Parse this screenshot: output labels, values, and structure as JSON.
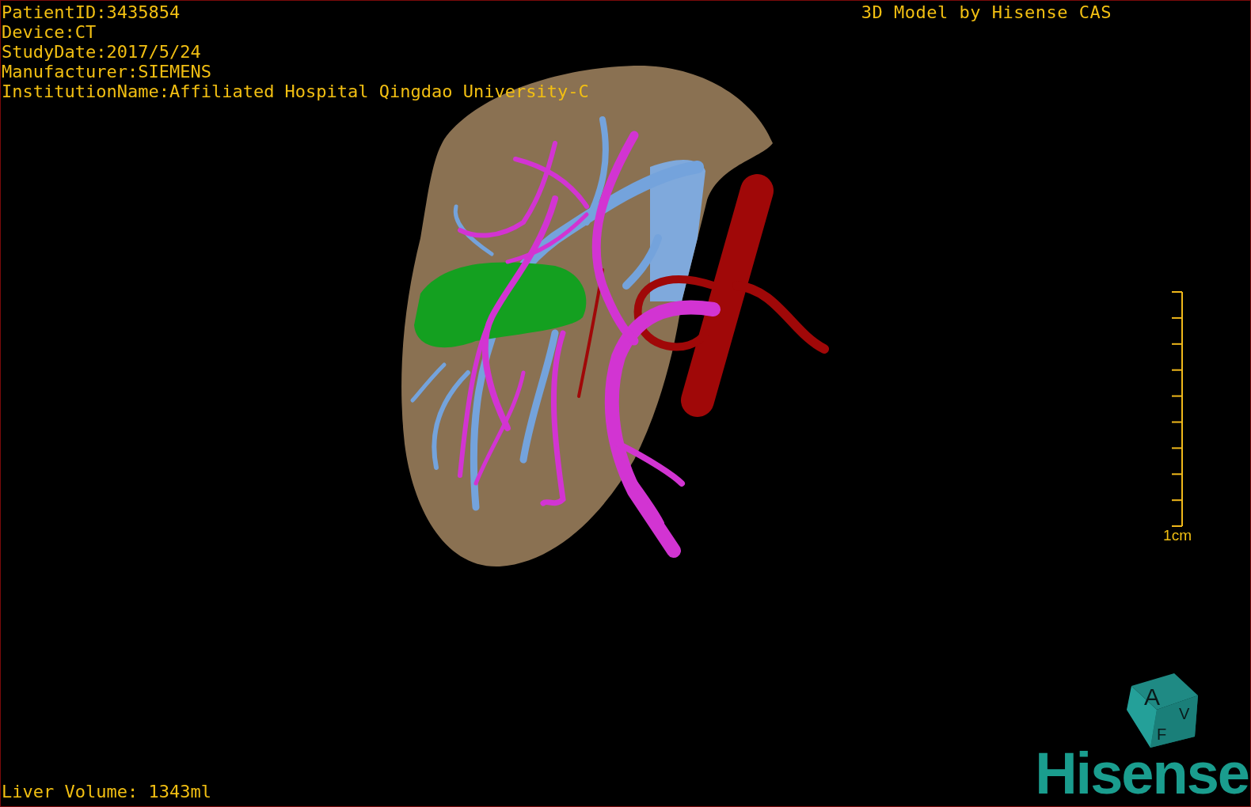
{
  "header": {
    "info_lines": [
      "PatientID:3435854",
      "Device:CT",
      "StudyDate:2017/5/24",
      "Manufacturer:SIEMENS",
      "InstitutionName:Affiliated Hospital Qingdao University-C"
    ],
    "caption": "3D Model by Hisense CAS"
  },
  "scale_bar": {
    "label": "1cm"
  },
  "orientation_cube": {
    "faces": [
      "A",
      "V",
      "F"
    ]
  },
  "logo": {
    "text": "Hisense"
  },
  "footer": {
    "liver_volume": "Liver Volume: 1343ml"
  }
}
